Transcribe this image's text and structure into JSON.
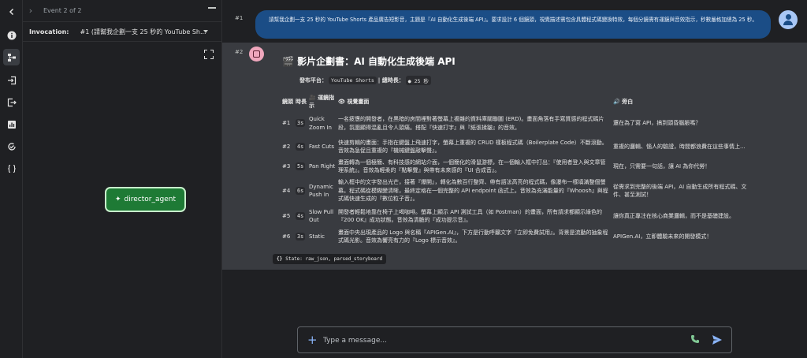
{
  "header": {
    "event_label": "Event 2 of 2"
  },
  "invocation": {
    "label": "Invocation:",
    "value": "#1 (請幫我企劃一支 25 秒的 YouTube Sh..."
  },
  "graph": {
    "node_label": "director_agent"
  },
  "user_turn": {
    "number": "#1",
    "text": "請幫我企劃一支 25 秒的 YouTube Shorts 產品廣告短影音，主題是『AI 自動化生成後端 API』。要求設計 6 個鏡頭，視覺描述需包含具體程式碼變換特效，每個分鏡需有運鏡與音效指示，秒數嚴格加總為 25 秒。"
  },
  "bot_turn": {
    "number": "#2",
    "title": "🎬 影片企劃書：AI 自動化生成後端 API",
    "platform_label": "發布平台：",
    "platform_value": "YouTube Shorts",
    "duration_label": "| 總時長：",
    "duration_value": "25 秒",
    "columns": {
      "scene": "鏡頭",
      "duration": "時長",
      "camera": "🎥 運鏡指示",
      "visual": "👁 視覺畫面",
      "voiceover": "🔊 旁白"
    },
    "rows": [
      {
        "scene": "#1",
        "duration": "3s",
        "camera": "Quick Zoom In",
        "visual": "一名疲憊的開發者，在黑暗的房間裡對著螢幕上複雜的資料庫關聯圖 (ERD)。畫面角落有手寫質感的程式碼片段，氛圍顯得混亂且令人頭痛。搭配『快速打字』與『紙張揉皺』的音效。",
        "voiceover": "還在為了寫 API，搞到頭昏腦脹嗎？"
      },
      {
        "scene": "#2",
        "duration": "4s",
        "camera": "Fast Cuts",
        "visual": "快速剪輯的畫面：手指在鍵盤上飛速打字，螢幕上重複的 CRUD 樣板程式碼（Boilerplate Code）不斷滾動。音效為急促且重複的『機械鍵盤敲擊聲』。",
        "voiceover": "重複的邏輯、惱人的驗證，時間都浪費在這些事情上..."
      },
      {
        "scene": "#3",
        "duration": "5s",
        "camera": "Pan Right",
        "visual": "畫面轉為一個極簡、有科技感的網站介面，一個簡化的滑鼠游標，在一個輸入框中打出：『使用者登入與文章管理系統』。音效為輕柔的『點擊聲』與帶有未來感的『UI 合成音』。",
        "voiceover": "現在，只需要一句話，讓 AI 為你代勞！"
      },
      {
        "scene": "#4",
        "duration": "6s",
        "camera": "Dynamic Push In",
        "visual": "輸入框中的文字發出光芒，接著『爆開』，轉化為數百行整齊、帶有語法高亮的程式碼，像瀑布一樣填滿整個螢幕。程式碼從模糊變清晰，最終定格在一個完整的 API endpoint 函式上。音效為充滿能量的『Whoosh』與程式碼快速生成的『數位粒子音』。",
        "voiceover": "從需求到完整的後端 API，AI 自動生成所有程式碼、文件、甚至測試！"
      },
      {
        "scene": "#5",
        "duration": "4s",
        "camera": "Slow Pull Out",
        "visual": "開發者輕鬆地靠在椅子上喝咖啡。螢幕上顯示 API 測試工具（如 Postman）的畫面，所有請求都顯示綠色的『200 OK』成功狀態。音效為清脆的『成功提示音』。",
        "voiceover": "讓你真正專注在核心商業邏輯，而不是基礎建設。"
      },
      {
        "scene": "#6",
        "duration": "3s",
        "camera": "Static",
        "visual": "畫面中央出現產品的 Logo 與名稱『APIGen.AI』，下方是行動呼籲文字『立即免費試用』。背景是流動的抽象程式碼光影。音效為響亮有力的『Logo 標示音效』。",
        "voiceover": "APIGen.AI，立即體驗未來的開發模式！"
      }
    ],
    "state_label": "State: raw_json, parsed_storyboard"
  },
  "composer": {
    "placeholder": "Type a message..."
  }
}
